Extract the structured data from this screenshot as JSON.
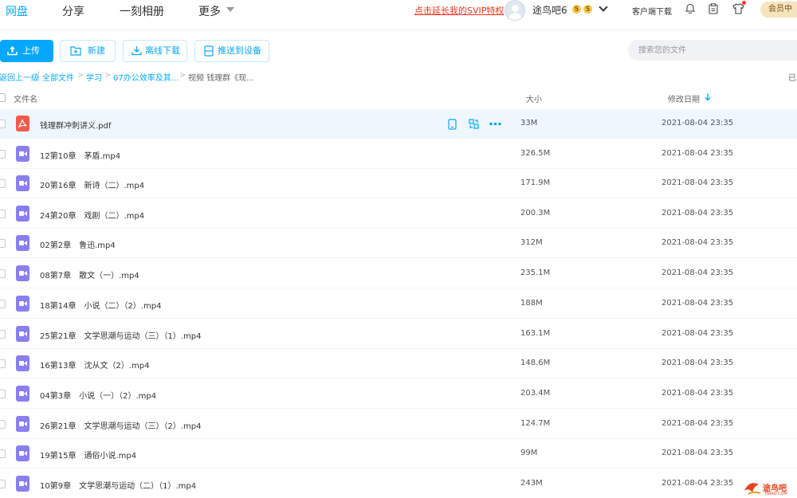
{
  "nav": {
    "tabs": [
      {
        "label": "网盘",
        "active": true
      },
      {
        "label": "分享",
        "active": false
      },
      {
        "label": "一刻相册",
        "active": false
      },
      {
        "label": "更多",
        "active": false
      }
    ],
    "svip_link": "点击延长我的SVIP特权",
    "username": "途鸟吧6",
    "badges": [
      "5",
      "5"
    ],
    "client_download": "客户端下载",
    "member_center": "会员中"
  },
  "toolbar": {
    "upload": "上传",
    "new": "新建",
    "offline_download": "离线下载",
    "push_to_device": "推送到设备",
    "search_placeholder": "搜索您的文件"
  },
  "breadcrumb": {
    "back": "返回上一级",
    "all_files": "全部文件",
    "study": "学习",
    "folder1": "07办公效率及其...",
    "current": "视频 钱理群《现...",
    "loaded": "已"
  },
  "table": {
    "col_name": "文件名",
    "col_size": "大小",
    "col_date": "修改日期",
    "rows": [
      {
        "name": "钱理群冲刺讲义.pdf",
        "size": "33M",
        "date": "2021-08-04 23:35",
        "type": "pdf"
      },
      {
        "name": "12第10章　茅盾.mp4",
        "size": "326.5M",
        "date": "2021-08-04 23:35",
        "type": "video"
      },
      {
        "name": "20第16章　新诗（二）.mp4",
        "size": "171.9M",
        "date": "2021-08-04 23:35",
        "type": "video"
      },
      {
        "name": "24第20章　戏剧（二）.mp4",
        "size": "200.3M",
        "date": "2021-08-04 23:35",
        "type": "video"
      },
      {
        "name": "02第2章　鲁迅.mp4",
        "size": "312M",
        "date": "2021-08-04 23:35",
        "type": "video"
      },
      {
        "name": "08第7章　散文（一）.mp4",
        "size": "235.1M",
        "date": "2021-08-04 23:35",
        "type": "video"
      },
      {
        "name": "18第14章　小说（二）（2）.mp4",
        "size": "188M",
        "date": "2021-08-04 23:35",
        "type": "video"
      },
      {
        "name": "25第21章　文学思潮与运动（三）（1）.mp4",
        "size": "163.1M",
        "date": "2021-08-04 23:35",
        "type": "video"
      },
      {
        "name": "16第13章　沈从文（2）.mp4",
        "size": "148.6M",
        "date": "2021-08-04 23:35",
        "type": "video"
      },
      {
        "name": "04第3章　小说（一）（2）.mp4",
        "size": "203.4M",
        "date": "2021-08-04 23:35",
        "type": "video"
      },
      {
        "name": "26第21章　文学思潮与运动（三）（2）.mp4",
        "size": "124.7M",
        "date": "2021-08-04 23:35",
        "type": "video"
      },
      {
        "name": "19第15章　通俗小说.mp4",
        "size": "99M",
        "date": "2021-08-04 23:35",
        "type": "video"
      },
      {
        "name": "10第9章　文学思潮与运动（二）（1）.mp4",
        "size": "243M",
        "date": "2021-08-04 23:35",
        "type": "video"
      }
    ]
  },
  "watermark": {
    "text": "途鸟吧",
    "sub": "TNIAO.COM"
  },
  "colors": {
    "accent": "#06a7ff",
    "svip_red": "#f0351c",
    "video_icon": "#8a7ff0",
    "pdf_icon": "#f25b4b",
    "selected_row": "#eef7fe"
  }
}
